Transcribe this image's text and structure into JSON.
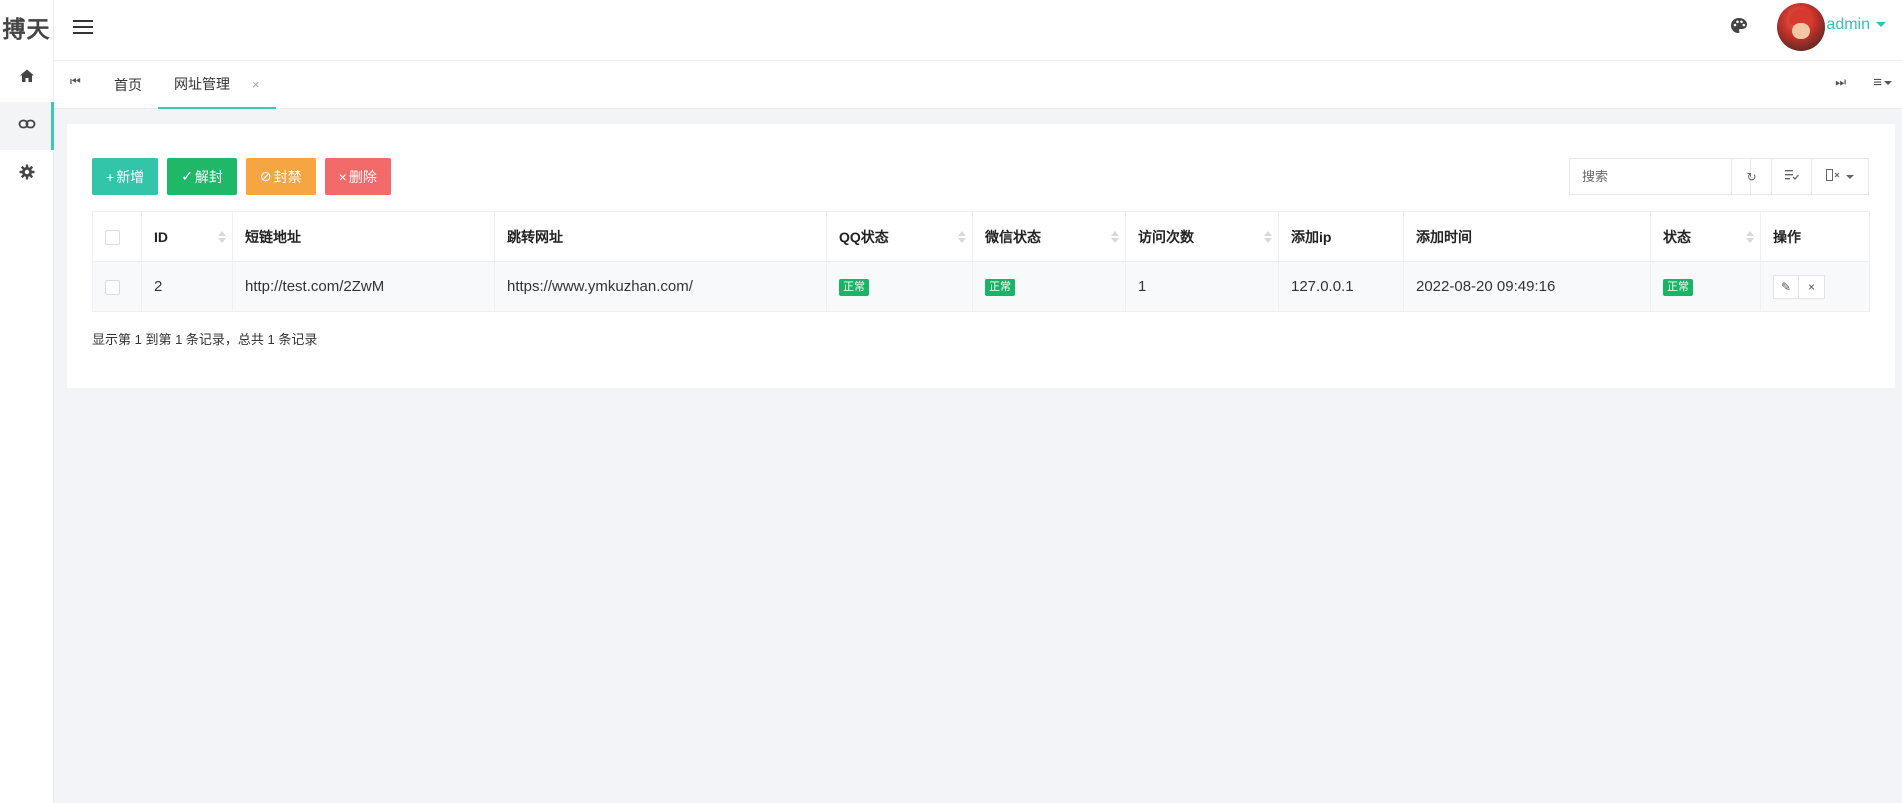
{
  "brand": {
    "logo_text": "搏天"
  },
  "sidebar": {
    "items": [
      {
        "icon": "home-icon",
        "active": false
      },
      {
        "icon": "link-icon",
        "active": true
      },
      {
        "icon": "gear-icon",
        "active": false
      }
    ]
  },
  "header": {
    "username": "admin"
  },
  "tabs": {
    "items": [
      {
        "label": "首页"
      },
      {
        "label": "网址管理",
        "close": "×"
      }
    ]
  },
  "toolbar": {
    "add_label": "新增",
    "unban_label": "解封",
    "ban_label": "封禁",
    "delete_label": "删除",
    "search_placeholder": "搜索"
  },
  "table": {
    "headers": [
      "ID",
      "短链地址",
      "跳转网址",
      "QQ状态",
      "微信状态",
      "访问次数",
      "添加ip",
      "添加时间",
      "状态",
      "操作"
    ],
    "rows": [
      {
        "id": "2",
        "short_url": "http://test.com/2ZwM",
        "target_url": "https://www.ymkuzhan.com/",
        "qq_status": "正常",
        "wechat_status": "正常",
        "visits": "1",
        "ip": "127.0.0.1",
        "added_time": "2022-08-20 09:49:16",
        "status": "正常"
      }
    ]
  },
  "pagination": {
    "info": "显示第 1 到第 1 条记录，总共 1 条记录"
  },
  "colors": {
    "accent": "#2ec4b6",
    "add": "#32c5a9",
    "unban": "#1fb869",
    "ban": "#f5a542",
    "delete": "#f26a6a",
    "status_ok": "#18b566"
  }
}
